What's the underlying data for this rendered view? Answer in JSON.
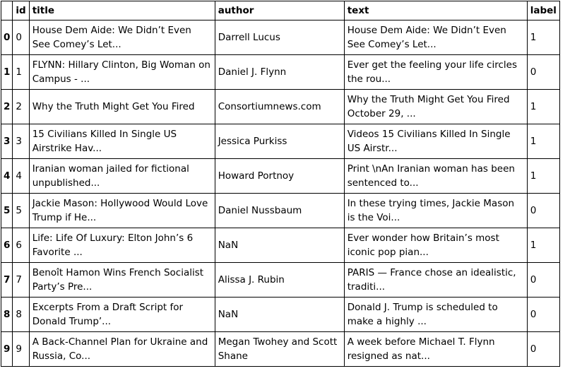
{
  "columns": [
    "",
    "id",
    "title",
    "author",
    "text",
    "label"
  ],
  "rows": [
    {
      "index": "0",
      "id": "0",
      "title": "House Dem Aide: We Didn’t Even See Comey’s Let...",
      "author": "Darrell Lucus",
      "text": "House Dem Aide: We Didn’t Even See Comey’s Let...",
      "label": "1"
    },
    {
      "index": "1",
      "id": "1",
      "title": "FLYNN: Hillary Clinton, Big Woman on Campus - ...",
      "author": "Daniel J. Flynn",
      "text": "Ever get the feeling your life circles the rou...",
      "label": "0"
    },
    {
      "index": "2",
      "id": "2",
      "title": "Why the Truth Might Get You Fired",
      "author": "Consortiumnews.com",
      "text": "Why the Truth Might Get You Fired October 29, ...",
      "label": "1"
    },
    {
      "index": "3",
      "id": "3",
      "title": "15 Civilians Killed In Single US Airstrike Hav...",
      "author": "Jessica Purkiss",
      "text": "Videos 15 Civilians Killed In Single US Airstr...",
      "label": "1"
    },
    {
      "index": "4",
      "id": "4",
      "title": "Iranian woman jailed for fictional unpublished...",
      "author": "Howard Portnoy",
      "text": "Print \\nAn Iranian woman has been sentenced to...",
      "label": "1"
    },
    {
      "index": "5",
      "id": "5",
      "title": "Jackie Mason: Hollywood Would Love Trump if He...",
      "author": "Daniel Nussbaum",
      "text": "In these trying times, Jackie Mason is the Voi...",
      "label": "0"
    },
    {
      "index": "6",
      "id": "6",
      "title": "Life: Life Of Luxury: Elton John’s 6 Favorite ...",
      "author": "NaN",
      "text": "Ever wonder how Britain’s most iconic pop pian...",
      "label": "1"
    },
    {
      "index": "7",
      "id": "7",
      "title": "Benoît Hamon Wins French Socialist Party’s Pre...",
      "author": "Alissa J. Rubin",
      "text": "PARIS — France chose an idealistic, traditi...",
      "label": "0"
    },
    {
      "index": "8",
      "id": "8",
      "title": "Excerpts From a Draft Script for Donald Trump’...",
      "author": "NaN",
      "text": "Donald J. Trump is scheduled to make a highly ...",
      "label": "0"
    },
    {
      "index": "9",
      "id": "9",
      "title": "A Back-Channel Plan for Ukraine and Russia, Co...",
      "author": "Megan Twohey and Scott Shane",
      "text": "A week before Michael T. Flynn resigned as nat...",
      "label": "0"
    }
  ]
}
